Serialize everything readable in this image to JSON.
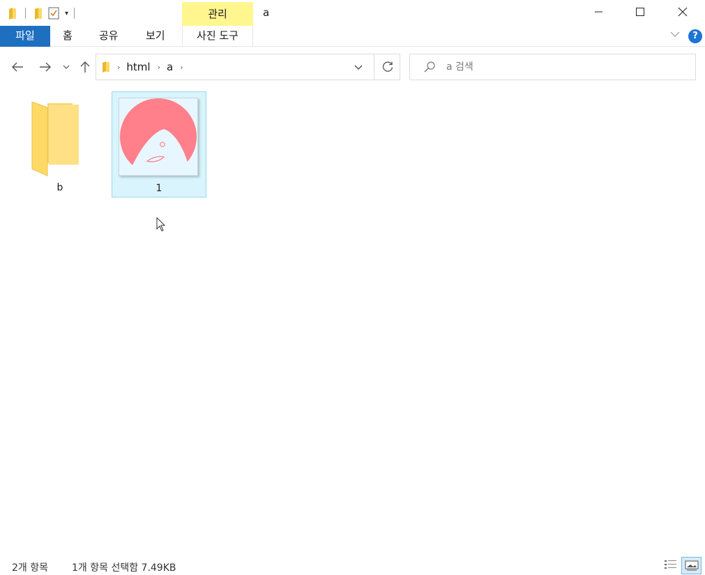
{
  "window": {
    "title": "a",
    "contextual_tab": "관리"
  },
  "ribbon": {
    "tabs": [
      {
        "label": "파일"
      },
      {
        "label": "홈"
      },
      {
        "label": "공유"
      },
      {
        "label": "보기"
      },
      {
        "label": "사진 도구"
      }
    ],
    "help_label": "?"
  },
  "address": {
    "crumbs": [
      "html",
      "a"
    ]
  },
  "search": {
    "placeholder": "a 검색"
  },
  "items": [
    {
      "name": "b",
      "type": "folder",
      "selected": false
    },
    {
      "name": "1",
      "type": "image",
      "selected": true
    }
  ],
  "status": {
    "item_count": "2개 항목",
    "selection": "1개 항목 선택함 7.49KB"
  },
  "colors": {
    "file_tab": "#1e6fc0",
    "contextual_tab": "#fff68f",
    "selection_bg": "#d9f4fc",
    "selection_border": "#99d9ea",
    "folder": "#ffd966",
    "thumb_circle": "#ff7f8a"
  }
}
